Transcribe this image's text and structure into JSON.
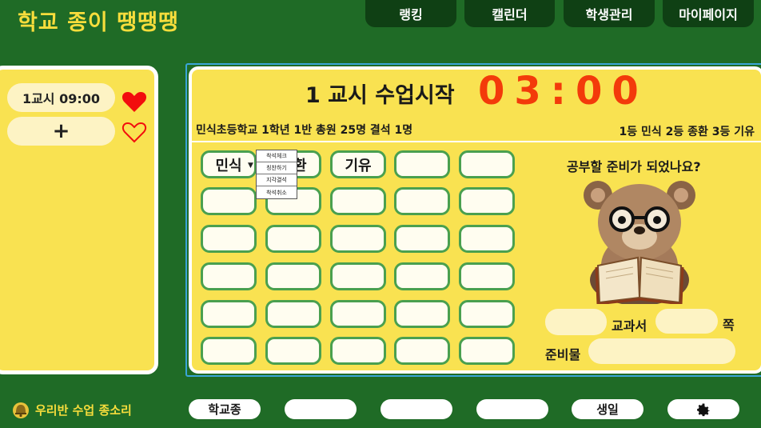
{
  "app": {
    "title": "학교 종이 땡땡땡"
  },
  "nav": {
    "items": [
      "랭킹",
      "캘린더",
      "학생관리",
      "마이페이지"
    ]
  },
  "left": {
    "period_time": "1교시 09:00",
    "add_label": "+"
  },
  "main": {
    "class_title": "1 교시 수업시작",
    "timer": "03:00",
    "info_left": "민식초등학교 1학년 1반  총원 25명 결석 1명",
    "info_right": "1등 민식 2등 종환 3등 기유",
    "seats": [
      "민식",
      "종환",
      "기유",
      "",
      "",
      "",
      "",
      "",
      "",
      "",
      "",
      "",
      "",
      "",
      "",
      "",
      "",
      "",
      "",
      "",
      "",
      "",
      "",
      "",
      "",
      "",
      "",
      "",
      "",
      ""
    ],
    "context_menu": [
      "착석체크",
      "칭찬하기",
      "지각결석",
      "착석취소"
    ],
    "question": "공부할 준비가 되었나요?",
    "textbook_label": "교과서",
    "page_label": "쪽",
    "supplies_label": "준비물"
  },
  "footer": {
    "logo_text": "우리반 수업 종소리",
    "buttons": [
      "학교종",
      "",
      "",
      "",
      "생일",
      ""
    ]
  },
  "colors": {
    "bg": "#1f6b26",
    "panel": "#f9e251",
    "accent": "#f33a0a",
    "seat_border": "#4aa04f",
    "heart": "#f20d0d"
  }
}
